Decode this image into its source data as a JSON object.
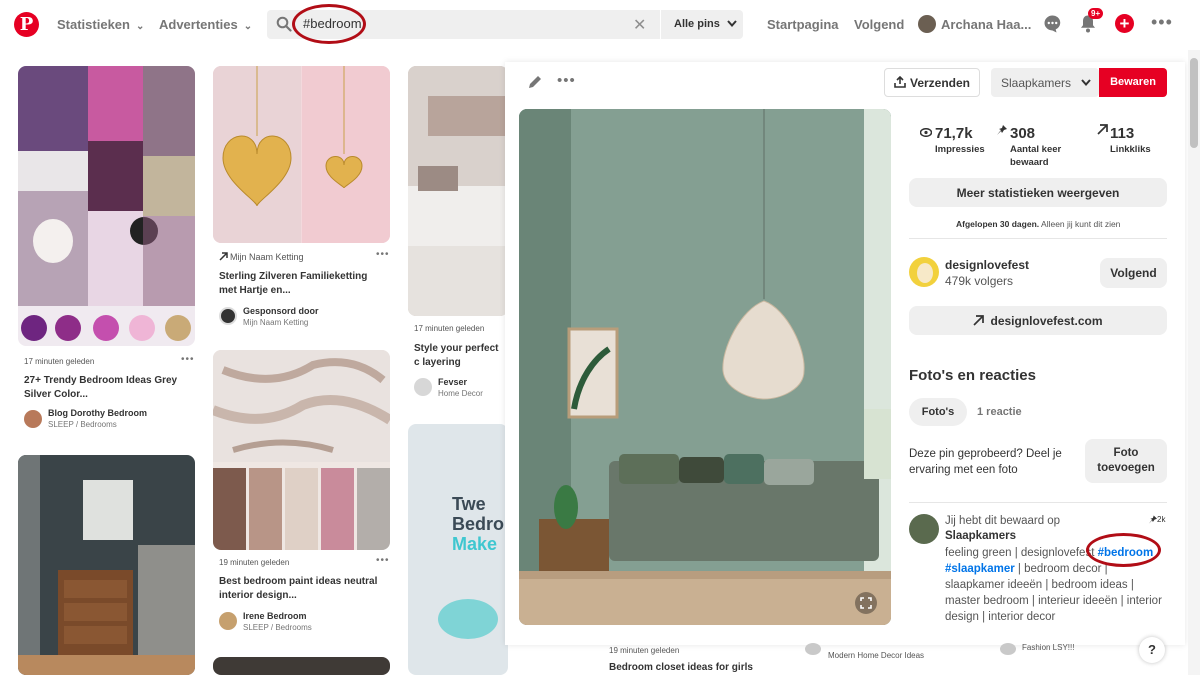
{
  "header": {
    "logo": "P",
    "nav_statistics": "Statistieken",
    "nav_ads": "Advertenties",
    "search_value": "#bedroom",
    "search_filter": "Alle pins",
    "nav_home": "Startpagina",
    "nav_following": "Volgend",
    "user_name": "Archana Haa...",
    "notifications_badge": "9+"
  },
  "feed": {
    "col1": [
      {
        "time": "17 minuten geleden",
        "title": "27+ Trendy Bedroom Ideas Grey Silver Color...",
        "source": "Blog Dorothy Bedroom",
        "board": "SLEEP / Bedrooms"
      }
    ],
    "col2": [
      {
        "attribution": "Mijn Naam Ketting",
        "title": "Sterling Zilveren Familieketting met Hartje en...",
        "source": "Gesponsord door",
        "board": "Mijn Naam Ketting"
      },
      {
        "time": "19 minuten geleden",
        "title": "Best bedroom paint ideas neutral interior design...",
        "source": "Irene Bedroom",
        "board": "SLEEP / Bedrooms"
      }
    ],
    "col3": [
      {
        "time": "17 minuten geleden",
        "title": "Style your perfect c layering colours...",
        "source": "Fevser",
        "board": "Home Decor"
      },
      {
        "image_text_1": "Twe",
        "image_text_2": "Bedro",
        "image_text_3": "Make"
      }
    ],
    "below_overlay": {
      "time": "19 minuten geleden",
      "title": "Bedroom closet ideas for girls",
      "board_a": "Modern Home Decor Ideas",
      "board_b": "Fashion LSY!!!"
    }
  },
  "pin_detail": {
    "send_label": "Verzenden",
    "board_select": "Slaapkamers",
    "save_label": "Bewaren",
    "stats": [
      {
        "value": "71,7k",
        "label": "Impressies"
      },
      {
        "value": "308",
        "label": "Aantal keer bewaard"
      },
      {
        "value": "113",
        "label": "Linkkliks"
      }
    ],
    "more_stats_button": "Meer statistieken weergeven",
    "stats_note_bold": "Afgelopen 30 dagen.",
    "stats_note": "Alleen jij kunt dit zien",
    "creator_name": "designlovefest",
    "creator_followers": "479k volgers",
    "follow_button": "Volgend",
    "link_button": "designlovefest.com",
    "photos_heading": "Foto's en reacties",
    "tab_photos": "Foto's",
    "tab_comments": "1 reactie",
    "tried_prompt": "Deze pin geprobeerd? Deel je ervaring met een foto",
    "add_photo_button": "Foto toevoegen",
    "saved_line": "Jij hebt dit bewaard op",
    "saved_board": "Slaapkamers",
    "saves_count": "2k",
    "desc_plain_1": "feeling green | designlovefest ",
    "desc_tag_1": "#bedroom",
    "desc_tag_2": "#slaapkamer",
    "desc_plain_2": " | bedroom decor | slaapkamer ideeën | bedroom ideas | master bedroom | interieur ideeën | interior design | interior decor",
    "help": "?"
  },
  "colors": {
    "brand": "#e60023",
    "annotation": "#b10d16",
    "link": "#0074e8"
  }
}
